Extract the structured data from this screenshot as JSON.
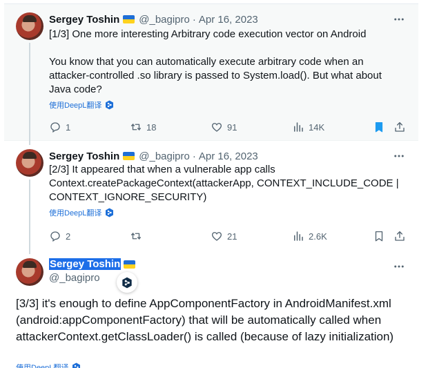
{
  "tweets": [
    {
      "name": "Sergey Toshin",
      "handle": "@_bagipro",
      "date": "Apr 16, 2023",
      "text_p1": "[1/3] One more interesting Arbitrary code execution vector on Android",
      "text_p2": "You know that you can automatically execute arbitrary code when an attacker-controlled .so library is passed to System.load(). But what about Java code?",
      "translate": "使用DeepL翻译",
      "replies": "1",
      "retweets": "18",
      "likes": "91",
      "views": "14K",
      "bookmarked": true
    },
    {
      "name": "Sergey Toshin",
      "handle": "@_bagipro",
      "date": "Apr 16, 2023",
      "text": "[2/3] It appeared that when a vulnerable app calls Context.createPackageContext(attackerApp, CONTEXT_INCLUDE_CODE | CONTEXT_IGNORE_SECURITY)",
      "translate": "使用DeepL翻译",
      "replies": "2",
      "retweets": "",
      "likes": "21",
      "views": "2.6K",
      "bookmarked": false
    },
    {
      "name": "Sergey Toshin",
      "handle": "@_bagipro",
      "text": "[3/3] it's enough to define AppComponentFactory in AndroidManifest.xml (android:appComponentFactory) that will be automatically called when attackerContext.getClassLoader() is called (because of lazy initialization)",
      "translate": "使用DeepL翻译"
    }
  ],
  "separator": "·",
  "colors": {
    "accent": "#1d9bf0",
    "text": "#0f1419",
    "muted": "#536471",
    "highlight": "#1d6ee8",
    "deepl": "#1d6fd8"
  },
  "icons": [
    "more-icon",
    "reply-icon",
    "retweet-icon",
    "like-icon",
    "views-icon",
    "bookmark-icon",
    "share-icon",
    "deepl-icon",
    "flag-ukraine-icon"
  ]
}
